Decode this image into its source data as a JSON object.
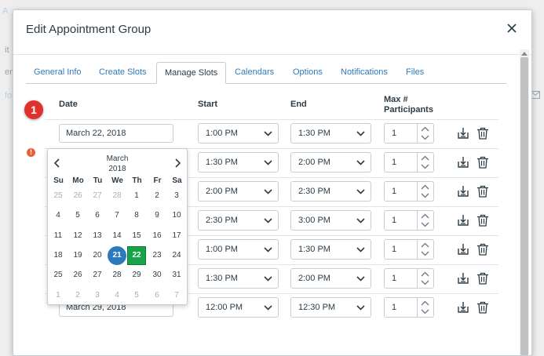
{
  "dialog": {
    "title": "Edit Appointment Group"
  },
  "tabs": [
    "General Info",
    "Create Slots",
    "Manage Slots",
    "Calendars",
    "Options",
    "Notifications",
    "Files"
  ],
  "active_tab": "Manage Slots",
  "columns": {
    "date": "Date",
    "start": "Start",
    "end": "End",
    "max": "Max #",
    "participants": "Participants"
  },
  "badge": "1",
  "rows": [
    {
      "date": "March 22, 2018",
      "start": "1:00 PM",
      "end": "1:30 PM",
      "max": "1"
    },
    {
      "date": "",
      "start": "1:30 PM",
      "end": "2:00 PM",
      "max": "1"
    },
    {
      "date": "",
      "start": "2:00 PM",
      "end": "2:30 PM",
      "max": "1"
    },
    {
      "date": "",
      "start": "2:30 PM",
      "end": "3:00 PM",
      "max": "1"
    },
    {
      "date": "",
      "start": "1:00 PM",
      "end": "1:30 PM",
      "max": "1"
    },
    {
      "date": "",
      "start": "1:30 PM",
      "end": "2:00 PM",
      "max": "1"
    },
    {
      "date": "March 29, 2018",
      "start": "12:00 PM",
      "end": "12:30 PM",
      "max": "1"
    }
  ],
  "calendar": {
    "month": "March",
    "year": "2018",
    "weekdays": [
      "Su",
      "Mo",
      "Tu",
      "We",
      "Th",
      "Fr",
      "Sa"
    ],
    "weeks": [
      [
        "25",
        "26",
        "27",
        "28",
        "1",
        "2",
        "3"
      ],
      [
        "4",
        "5",
        "6",
        "7",
        "8",
        "9",
        "10"
      ],
      [
        "11",
        "12",
        "13",
        "14",
        "15",
        "16",
        "17"
      ],
      [
        "18",
        "19",
        "20",
        "21",
        "22",
        "23",
        "24"
      ],
      [
        "25",
        "26",
        "27",
        "28",
        "29",
        "30",
        "31"
      ],
      [
        "1",
        "2",
        "3",
        "4",
        "5",
        "6",
        "7"
      ]
    ],
    "today": "21",
    "selected": "22"
  },
  "background_text": [
    "A",
    "it",
    "en",
    "fo"
  ],
  "colors": {
    "accent": "#2b7abc",
    "selected": "#16a34a",
    "badge": "#e0312f",
    "warning": "#e66135"
  }
}
